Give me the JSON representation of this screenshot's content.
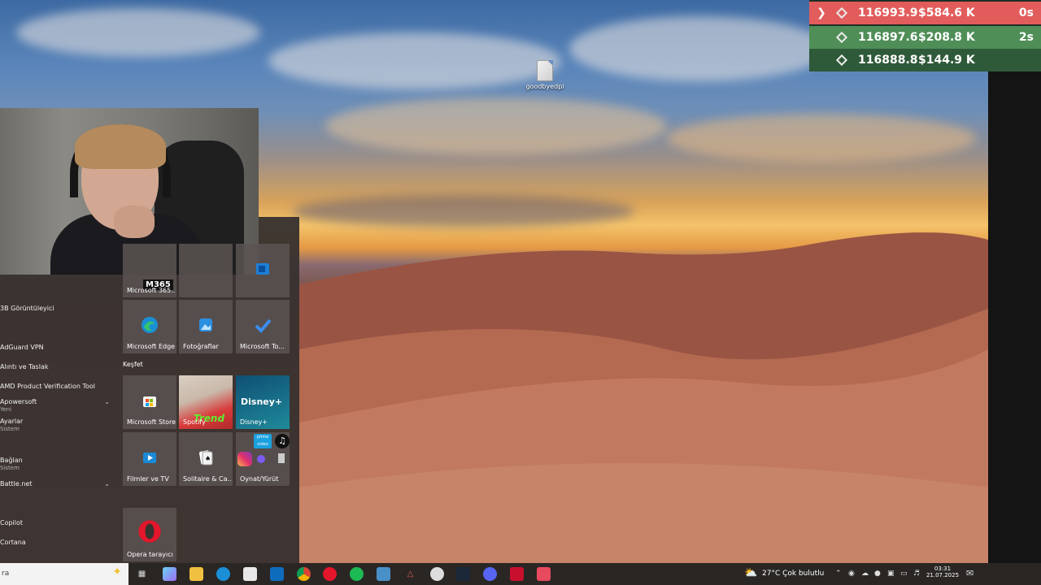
{
  "desktop": {
    "icon_label": "goodbyedpi"
  },
  "ticker": {
    "rows": [
      {
        "price": "116993.9",
        "amount": "$584.6 K",
        "age": "0s",
        "color": "#e25c5c"
      },
      {
        "price": "116897.6",
        "amount": "$208.8 K",
        "age": "2s",
        "color": "#4f8e57"
      },
      {
        "price": "116888.8",
        "amount": "$144.9 K",
        "age": "",
        "color": "#2f5a3a"
      }
    ]
  },
  "start_menu": {
    "apps": [
      {
        "label": "3B Görüntüleyici"
      },
      {
        "label": "AdGuard VPN"
      },
      {
        "label": "Alıntı ve Taslak"
      },
      {
        "label": "AMD Product Verification Tool"
      },
      {
        "label": "Apowersoft",
        "sub": "Yeni"
      },
      {
        "label": "Ayarlar",
        "sub": "Sistem"
      },
      {
        "label": "Bağlan",
        "sub": "Sistem"
      },
      {
        "label": "Battle.net"
      },
      {
        "label": "Copilot"
      },
      {
        "label": "Cortana"
      }
    ],
    "tiles": {
      "m365_badge": "M365",
      "m365": "Microsoft 365...",
      "edge": "Microsoft Edge",
      "photos": "Fotoğraflar",
      "todo": "Microsoft To...",
      "store": "Microsoft Store",
      "spotify": "Spotify",
      "disney": "Disney+",
      "films": "Filmler ve TV",
      "solitaire": "Solitaire & Ca...",
      "play": "Oynat/Yürüt",
      "opera": "Opera tarayıcı",
      "spotify_art": "Trend",
      "disney_art": "Disney+",
      "prime_art": "prime video"
    },
    "section_explore": "Keşfet"
  },
  "taskbar": {
    "search_text": "ra",
    "weather": "27°C  Çok bulutlu",
    "time": "03:31",
    "date": "21.07.2025"
  },
  "colors": {
    "taskbar": "#2a2624",
    "start_menu": "#383230",
    "ticker_sell": "#e25c5c",
    "ticker_buy": "#4f8e57"
  }
}
